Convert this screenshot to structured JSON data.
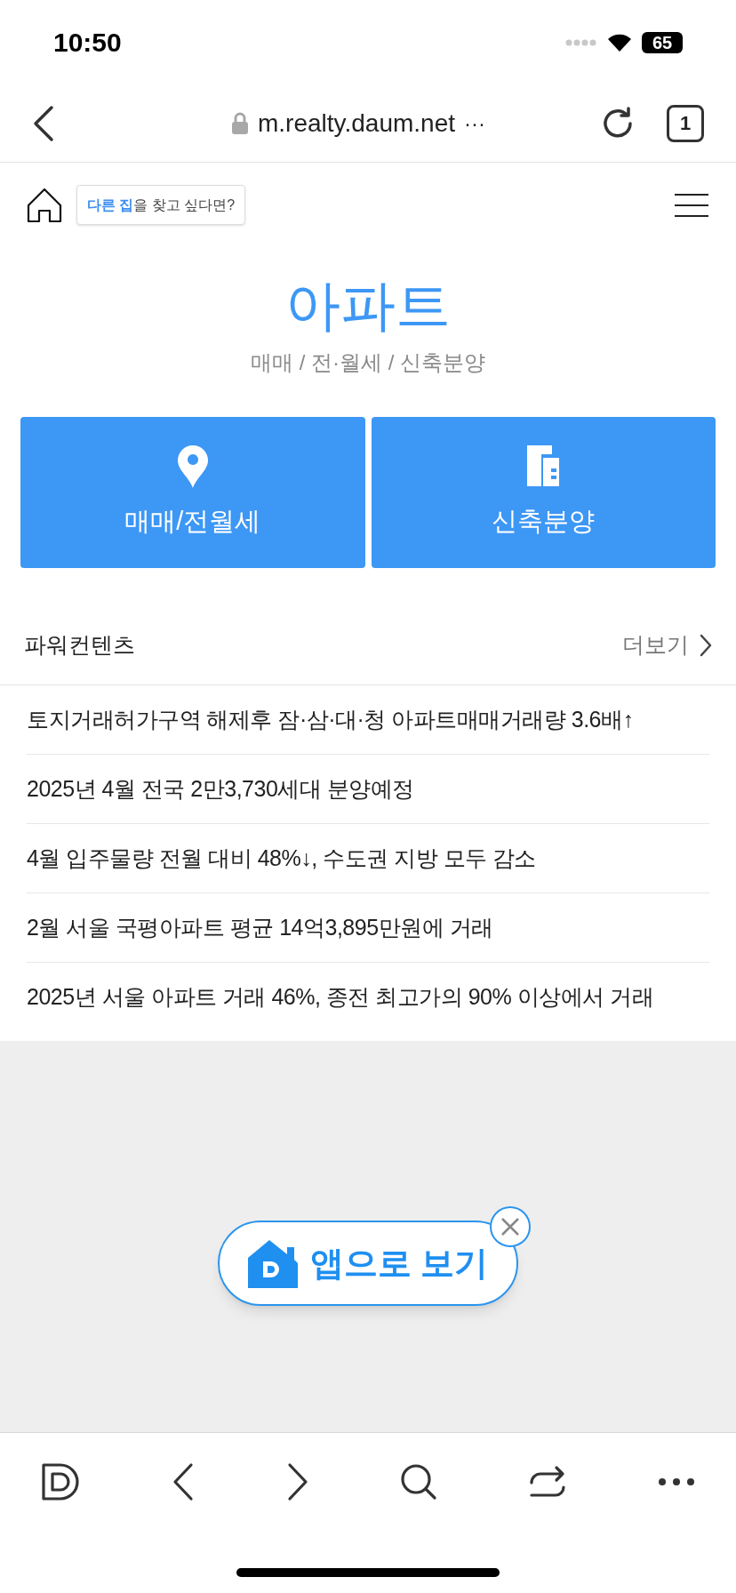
{
  "status_bar": {
    "time": "10:50",
    "battery": "65"
  },
  "browser_bar": {
    "url": "m.realty.daum.net",
    "more": "···",
    "tab_count": "1"
  },
  "header": {
    "tooltip": "**다른 집**을 찾고 싶다면?"
  },
  "hero": {
    "title": "아파트",
    "subtitle": "매매 / 전·월세 / 신축분양"
  },
  "tiles": [
    {
      "kind": "pin",
      "label": "매매/전월세"
    },
    {
      "kind": "building",
      "label": "신축분양"
    }
  ],
  "power_contents": {
    "title": "파워컨텐츠",
    "more": "더보기",
    "items": [
      "토지거래허가구역 해제후 잠·삼·대·청 아파트매매거래량 3.6배↑",
      "2025년 4월 전국 2만3,730세대 분양예정",
      "4월 입주물량 전월 대비 48%↓, 수도권 지방 모두 감소",
      "2월 서울 국평아파트 평균 14억3,895만원에 거래",
      "2025년 서울 아파트 거래 46%, 종전 최고가의 90% 이상에서 거래"
    ]
  },
  "app_banner": {
    "label": "앱으로 보기"
  }
}
